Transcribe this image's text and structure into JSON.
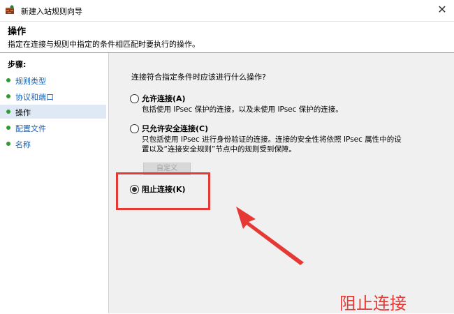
{
  "window": {
    "title": "新建入站规则向导",
    "close_symbol": "✕"
  },
  "header": {
    "title": "操作",
    "description": "指定在连接与规则中指定的条件相匹配时要执行的操作。"
  },
  "sidebar": {
    "heading": "步骤:",
    "items": [
      {
        "label": "规则类型"
      },
      {
        "label": "协议和端口"
      },
      {
        "label": "操作"
      },
      {
        "label": "配置文件"
      },
      {
        "label": "名称"
      }
    ]
  },
  "main": {
    "question": "连接符合指定条件时应该进行什么操作?",
    "options": [
      {
        "label": "允许连接(A)",
        "desc1": "包括使用 IPsec 保护的连接，以及未使用 IPsec 保护的连接。",
        "desc2": "",
        "selected": false
      },
      {
        "label": "只允许安全连接(C)",
        "desc1": "只包括使用 IPsec 进行身份验证的连接。连接的安全性将依照 IPsec 属性中的设",
        "desc2": "置以及“连接安全规则”节点中的规则受到保障。",
        "selected": false
      },
      {
        "label": "阻止连接(K)",
        "desc1": "",
        "desc2": "",
        "selected": true
      }
    ],
    "customize_button": "自定义"
  },
  "annotation": {
    "text": "阻止连接",
    "color": "#e53935"
  }
}
